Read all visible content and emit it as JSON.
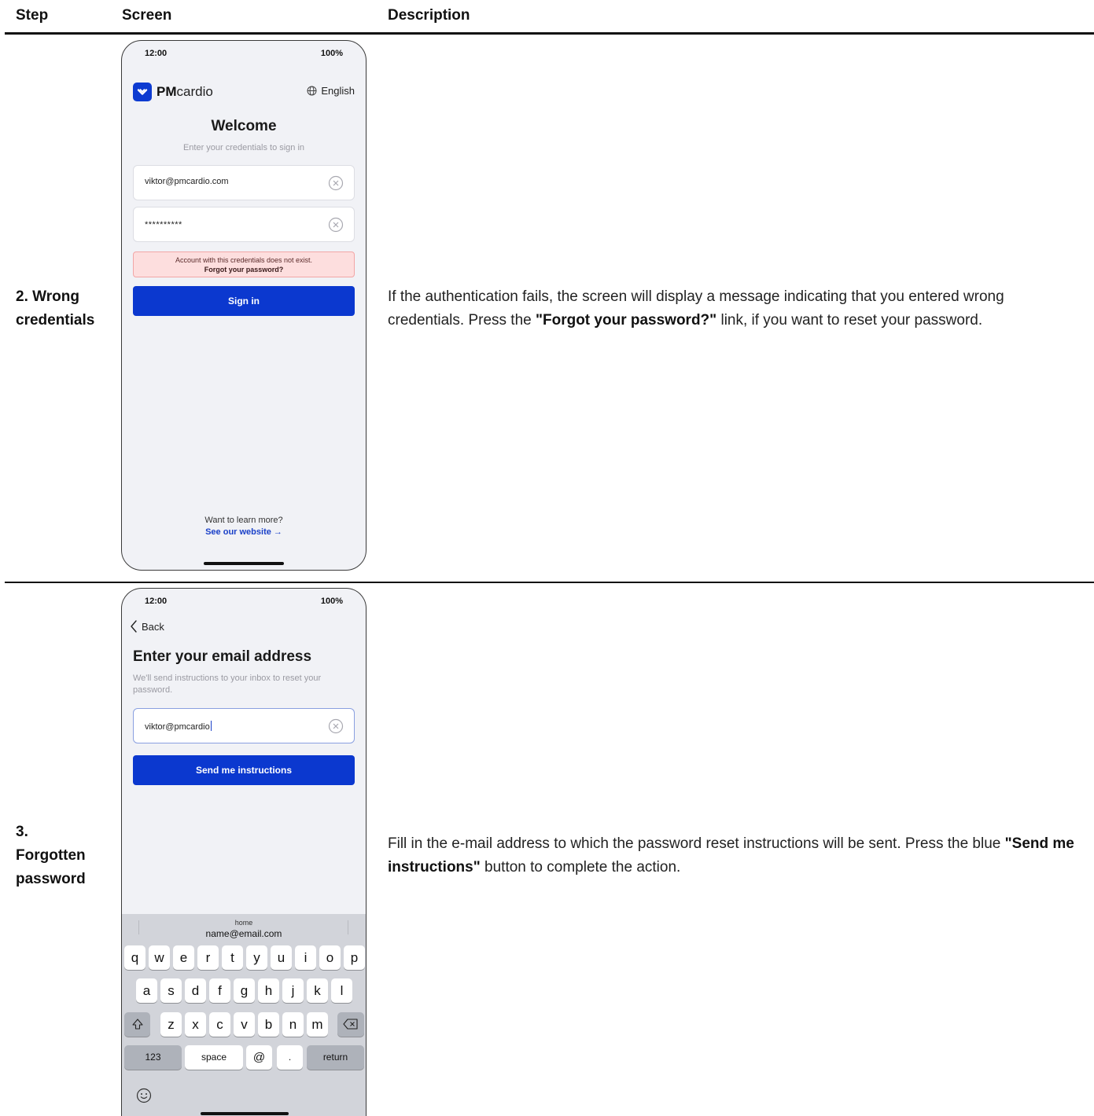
{
  "table": {
    "header_step": "Step",
    "header_screen": "Screen",
    "header_description": "Description"
  },
  "rows": [
    {
      "step_line1": "2. Wrong",
      "step_line2": "credentials",
      "desc_text1": "If the authentication fails, the screen will display a message indicating that you entered wrong credentials. Press the ",
      "desc_bold1": "\"Forgot your password?",
      "desc_bold1_suffix": "\"",
      "desc_text2": " link, if you want to reset your password."
    },
    {
      "step_line1": "3.",
      "step_line2": "Forgotten",
      "step_line3": "password",
      "desc_text1": "Fill in the e-mail address to which the password reset instructions will be sent. Press the blue ",
      "desc_bold1": "\"Send me instructions\"",
      "desc_text2": " button to complete the action."
    }
  ],
  "phone1": {
    "status_time": "12:00",
    "status_battery": "100%",
    "brand_pm": "PM",
    "brand_cardio": "cardio",
    "language": "English",
    "title": "Welcome",
    "subtitle": "Enter your credentials to sign in",
    "email_value": "viktor@pmcardio.com",
    "password_value": "**********",
    "error_message": "Account with this credentials does not exist.",
    "error_link": "Forgot your password?",
    "signin_label": "Sign in",
    "learn_more": "Want to learn more?",
    "website_link": "See our website →",
    "accent_color": "#0b38cf",
    "error_bg_color": "#fddede"
  },
  "phone2": {
    "status_time": "12:00",
    "status_battery": "100%",
    "back_label": "Back",
    "title": "Enter your email address",
    "subtitle": "We'll send instructions to your inbox to reset your password.",
    "email_value": "viktor@pmcardio",
    "send_label": "Send me instructions",
    "keyboard": {
      "suggestion_label": "home",
      "suggestion_value": "name@email.com",
      "row1": [
        "q",
        "w",
        "e",
        "r",
        "t",
        "y",
        "u",
        "i",
        "o",
        "p"
      ],
      "row2": [
        "a",
        "s",
        "d",
        "f",
        "g",
        "h",
        "j",
        "k",
        "l"
      ],
      "row3": [
        "z",
        "x",
        "c",
        "v",
        "b",
        "n",
        "m"
      ],
      "numbers_key": "123",
      "space_key": "space",
      "at_key": "@",
      "dot_key": ".",
      "return_key": "return"
    }
  }
}
